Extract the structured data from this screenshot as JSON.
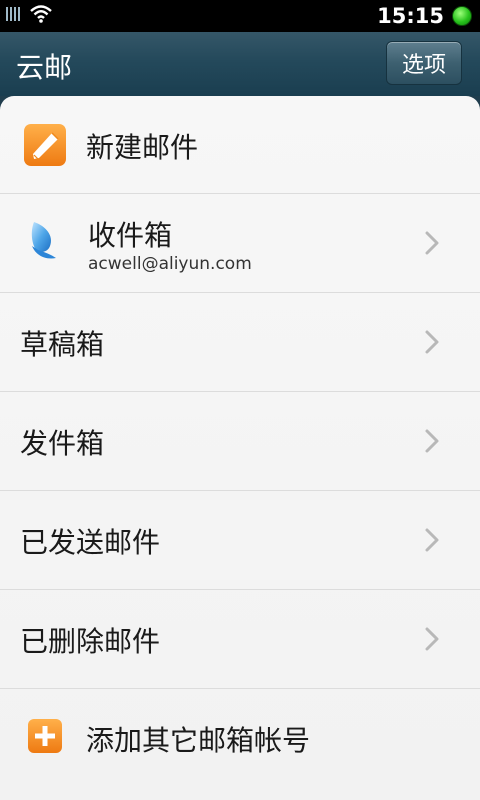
{
  "status_bar": {
    "time": "15:15",
    "icons": [
      "signal-icon",
      "wifi-icon",
      "status-dot-icon"
    ]
  },
  "header": {
    "title": "云邮",
    "options_label": "选项"
  },
  "menu": {
    "new_mail": {
      "label": "新建邮件",
      "icon": "pencil-icon"
    },
    "inbox": {
      "label": "收件箱",
      "account": "acwell@aliyun.com",
      "icon": "butterfly-icon"
    },
    "drafts": {
      "label": "草稿箱"
    },
    "outbox": {
      "label": "发件箱"
    },
    "sent": {
      "label": "已发送邮件"
    },
    "deleted": {
      "label": "已删除邮件"
    },
    "add_account": {
      "label": "添加其它邮箱帐号",
      "icon": "plus-icon"
    }
  },
  "colors": {
    "accent_orange": "#f08a1c",
    "title_bar": "#24495b",
    "status_green": "#27c21c"
  }
}
